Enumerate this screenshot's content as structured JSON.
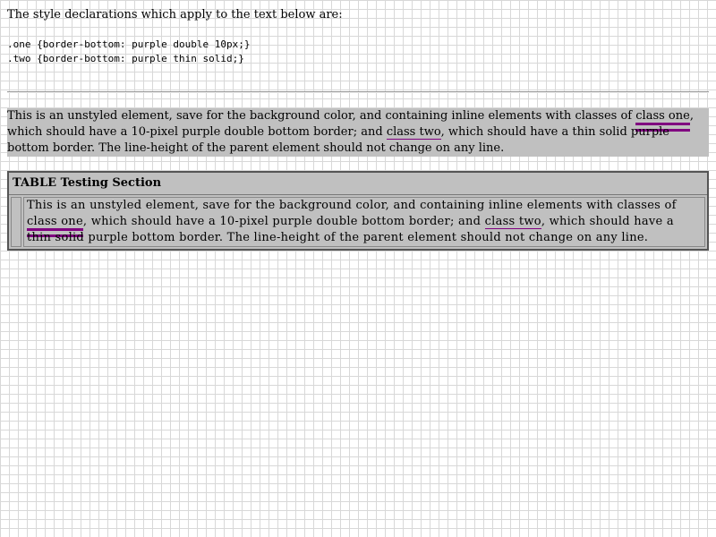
{
  "intro": {
    "text": "The style declarations which apply to the text below are:"
  },
  "code": {
    "line1": ".one {border-bottom: purple double 10px;}",
    "line2": ".two {border-bottom: purple thin solid;}"
  },
  "paragraph": {
    "part1": "This is an unstyled element, save for the background color, and containing inline elements with classes of ",
    "class_one": "class one",
    "part2": ", which should have a 10-pixel purple double bottom border; and ",
    "class_two": "class two",
    "part3": ", which should have a thin solid purple bottom border. The line-height of the parent element should not change on any line."
  },
  "table": {
    "header": "TABLE Testing Section",
    "part1": "This is an unstyled element, save for the background color, and containing inline elements with classes of ",
    "class_one": "class one",
    "part2": ", which should have a 10-pixel purple double bottom border; and ",
    "class_two": "class two",
    "part3": ", which should have a thin solid purple bottom border. The line-height of the parent element should not change on any line."
  },
  "colors": {
    "block_background": "#c0c0c0",
    "border_accent": "purple"
  }
}
